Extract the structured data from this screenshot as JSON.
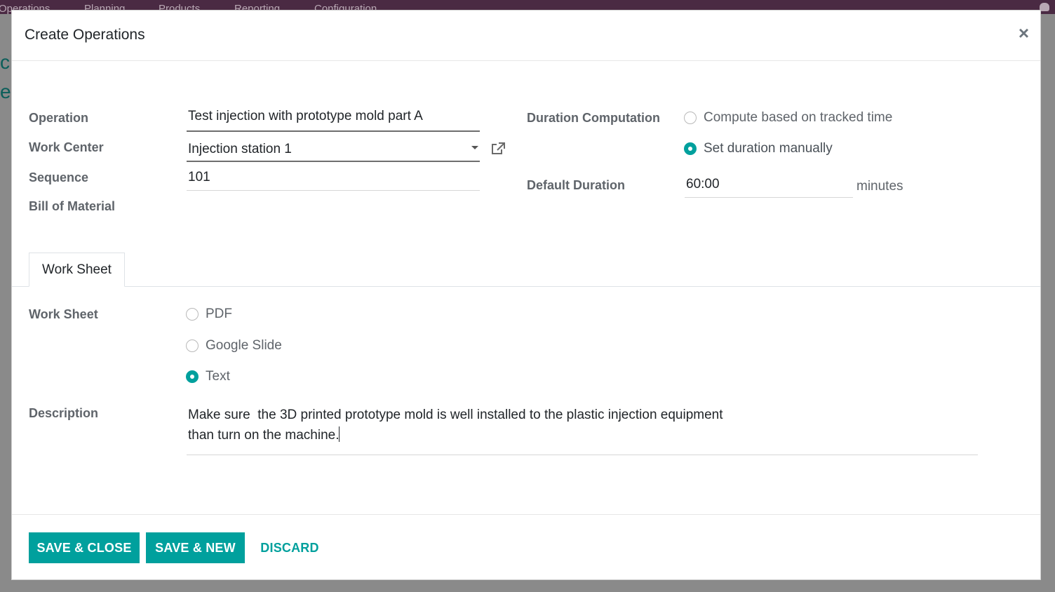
{
  "background": {
    "nav_items": [
      "Operations",
      "Planning",
      "Products",
      "Reporting",
      "Configuration"
    ],
    "side_text": [
      "ch",
      "e"
    ]
  },
  "modal": {
    "title": "Create Operations",
    "close_symbol": "×"
  },
  "form": {
    "operation": {
      "label": "Operation",
      "value": "Test injection with prototype mold part A"
    },
    "work_center": {
      "label": "Work Center",
      "value": "Injection station 1"
    },
    "sequence": {
      "label": "Sequence",
      "value": "101"
    },
    "bill_of_material": {
      "label": "Bill of Material",
      "value": ""
    },
    "duration_computation": {
      "label": "Duration Computation",
      "options": [
        {
          "label": "Compute based on tracked time",
          "checked": false
        },
        {
          "label": "Set duration manually",
          "checked": true
        }
      ]
    },
    "default_duration": {
      "label": "Default Duration",
      "value": "60:00",
      "unit": "minutes"
    }
  },
  "tabs": [
    {
      "label": "Work Sheet",
      "active": true
    }
  ],
  "worksheet": {
    "label": "Work Sheet",
    "options": [
      {
        "label": "PDF",
        "checked": false
      },
      {
        "label": "Google Slide",
        "checked": false
      },
      {
        "label": "Text",
        "checked": true
      }
    ]
  },
  "description": {
    "label": "Description",
    "lines": [
      "Make sure  the 3D printed prototype mold is well installed to the plastic injection equipment",
      "than turn on the machine."
    ]
  },
  "footer": {
    "save_close": "SAVE & CLOSE",
    "save_new": "SAVE & NEW",
    "discard": "DISCARD"
  },
  "colors": {
    "accent": "#00a09d",
    "nav_bg": "#4a2a43"
  }
}
